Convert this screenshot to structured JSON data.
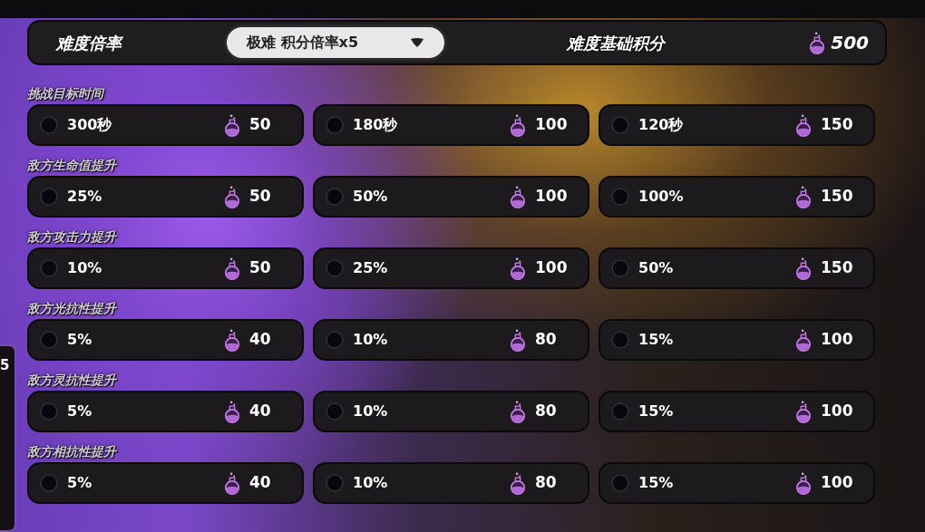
{
  "header": {
    "label": "难度倍率",
    "dropdown": {
      "value": "极难 积分倍率x5"
    },
    "base_label": "难度基础积分",
    "base_value": "500"
  },
  "side_panel": {
    "text": "5"
  },
  "groups": [
    {
      "title": "挑战目标时间",
      "options": [
        {
          "label": "300秒",
          "points": "50",
          "selected": false
        },
        {
          "label": "180秒",
          "points": "100",
          "selected": false
        },
        {
          "label": "120秒",
          "points": "150",
          "selected": false
        }
      ]
    },
    {
      "title": "敌方生命值提升",
      "options": [
        {
          "label": "25%",
          "points": "50",
          "selected": false
        },
        {
          "label": "50%",
          "points": "100",
          "selected": false
        },
        {
          "label": "100%",
          "points": "150",
          "selected": false
        }
      ]
    },
    {
      "title": "敌方攻击力提升",
      "options": [
        {
          "label": "10%",
          "points": "50",
          "selected": false
        },
        {
          "label": "25%",
          "points": "100",
          "selected": false
        },
        {
          "label": "50%",
          "points": "150",
          "selected": false
        }
      ]
    },
    {
      "title": "敌方光抗性提升",
      "options": [
        {
          "label": "5%",
          "points": "40",
          "selected": false
        },
        {
          "label": "10%",
          "points": "80",
          "selected": false
        },
        {
          "label": "15%",
          "points": "100",
          "selected": false
        }
      ]
    },
    {
      "title": "敌方灵抗性提升",
      "options": [
        {
          "label": "5%",
          "points": "40",
          "selected": false
        },
        {
          "label": "10%",
          "points": "80",
          "selected": false
        },
        {
          "label": "15%",
          "points": "100",
          "selected": false
        }
      ]
    },
    {
      "title": "敌方相抗性提升",
      "options": [
        {
          "label": "5%",
          "points": "40",
          "selected": false
        },
        {
          "label": "10%",
          "points": "80",
          "selected": false
        },
        {
          "label": "15%",
          "points": "100",
          "selected": false
        }
      ]
    }
  ]
}
